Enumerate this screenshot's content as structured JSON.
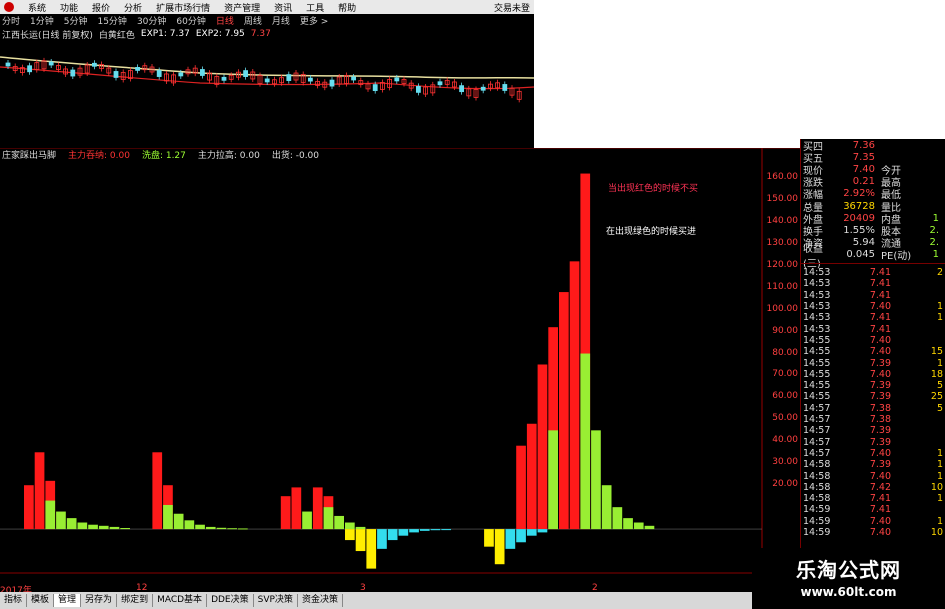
{
  "menu": {
    "items": [
      "系统",
      "功能",
      "报价",
      "分析",
      "扩展市场行情",
      "资产管理",
      "资讯",
      "工具",
      "帮助"
    ],
    "right": "交易未登"
  },
  "periods": {
    "items": [
      "分时",
      "1分钟",
      "5分钟",
      "15分钟",
      "30分钟",
      "60分钟",
      "日线",
      "周线",
      "月线",
      "更多 >"
    ],
    "selected": 6
  },
  "stock_title": {
    "name": "江西长运(日线 前复权)",
    "series": "白黄红色",
    "exp1": "EXP1: 7.37",
    "exp2": "EXP2: 7.95",
    "value3": "7.37"
  },
  "indicator_bar": {
    "name": "庄家踩出马脚",
    "k1": "主力吞纳: 0.00",
    "k2": "洗盘: 1.27",
    "k3": "主力拉高: 0.00",
    "k4": "出货: -0.00"
  },
  "annotations": {
    "red_text": "当出现红色的时候不买",
    "white_text": "在出现绿色的时候买进"
  },
  "colors": {
    "red": "#ff1a1a",
    "green": "#99ee33",
    "yellow": "#ffee00",
    "cyan": "#33ddee"
  },
  "chart_data": {
    "type": "bar",
    "ylim": [
      -20,
      170
    ],
    "yticks": [
      20,
      30,
      40,
      50,
      60,
      70,
      80,
      90,
      100,
      110,
      120,
      130,
      140,
      150,
      160
    ],
    "series": [
      {
        "color": "red",
        "values": [
          [
            0,
            0,
            20
          ],
          [
            1,
            0,
            35
          ],
          [
            2,
            0,
            22
          ],
          [
            12,
            0,
            35
          ],
          [
            13,
            0,
            20
          ],
          [
            24,
            0,
            15
          ],
          [
            25,
            0,
            19
          ],
          [
            27,
            0,
            19
          ],
          [
            28,
            0,
            15
          ],
          [
            46,
            0,
            38
          ],
          [
            47,
            0,
            48
          ],
          [
            48,
            0,
            75
          ],
          [
            49,
            0,
            92
          ],
          [
            50,
            0,
            108
          ],
          [
            51,
            0,
            122
          ],
          [
            52,
            0,
            162
          ]
        ]
      },
      {
        "color": "green",
        "values": [
          [
            2,
            0,
            13
          ],
          [
            3,
            0,
            8
          ],
          [
            4,
            0,
            5
          ],
          [
            5,
            0,
            3
          ],
          [
            6,
            0,
            2
          ],
          [
            7,
            0,
            1.5
          ],
          [
            8,
            0,
            1
          ],
          [
            9,
            0,
            0.5
          ],
          [
            13,
            0,
            11
          ],
          [
            14,
            0,
            7
          ],
          [
            15,
            0,
            4
          ],
          [
            16,
            0,
            2
          ],
          [
            17,
            0,
            1
          ],
          [
            18,
            0,
            0.6
          ],
          [
            19,
            0,
            0.4
          ],
          [
            20,
            0,
            0.3
          ],
          [
            26,
            0,
            8
          ],
          [
            28,
            0,
            10
          ],
          [
            29,
            0,
            6
          ],
          [
            30,
            0,
            3
          ],
          [
            31,
            0,
            1
          ],
          [
            49,
            0,
            45
          ],
          [
            52,
            0,
            80
          ],
          [
            53,
            0,
            45
          ],
          [
            54,
            0,
            20
          ],
          [
            55,
            0,
            10
          ],
          [
            56,
            0,
            5
          ],
          [
            57,
            0,
            3
          ],
          [
            58,
            0,
            1.5
          ]
        ]
      },
      {
        "color": "yellow",
        "values": [
          [
            30,
            -5,
            0
          ],
          [
            31,
            -10,
            0
          ],
          [
            32,
            -18,
            0
          ],
          [
            43,
            -8,
            0
          ],
          [
            44,
            -16,
            0
          ]
        ]
      },
      {
        "color": "cyan",
        "values": [
          [
            33,
            -9,
            0
          ],
          [
            34,
            -5,
            0
          ],
          [
            35,
            -3,
            0
          ],
          [
            36,
            -1.5,
            0
          ],
          [
            37,
            -0.8,
            0
          ],
          [
            38,
            -0.5,
            0
          ],
          [
            39,
            -0.3,
            0
          ],
          [
            45,
            -9,
            0
          ],
          [
            46,
            -6,
            0
          ],
          [
            47,
            -3,
            0
          ],
          [
            48,
            -1.5,
            0
          ]
        ]
      }
    ]
  },
  "xaxis": [
    {
      "label": "2017年",
      "pos": 0.0
    },
    {
      "label": "12",
      "pos": 0.17
    },
    {
      "label": "3",
      "pos": 0.45
    },
    {
      "label": "2",
      "pos": 0.74
    }
  ],
  "quote": {
    "rows": [
      {
        "lab": "买四",
        "val": "7.36",
        "vcolor": "#ff4444",
        "lab2": "",
        "val2": ""
      },
      {
        "lab": "买五",
        "val": "7.35",
        "vcolor": "#ff4444",
        "lab2": "",
        "val2": ""
      },
      {
        "lab": "现价",
        "val": "7.40",
        "vcolor": "#ff4444",
        "lab2": "今开",
        "val2": ""
      },
      {
        "lab": "涨跌",
        "val": "0.21",
        "vcolor": "#ff4444",
        "lab2": "最高",
        "val2": ""
      },
      {
        "lab": "涨幅",
        "val": "2.92%",
        "vcolor": "#ff4444",
        "lab2": "最低",
        "val2": ""
      },
      {
        "lab": "总量",
        "val": "36728",
        "vcolor": "#ffd700",
        "lab2": "量比",
        "val2": ""
      },
      {
        "lab": "外盘",
        "val": "20409",
        "vcolor": "#ff4444",
        "lab2": "内盘",
        "val2": "1"
      },
      {
        "lab": "换手",
        "val": "1.55%",
        "vcolor": "#ddd",
        "lab2": "股本",
        "val2": "2."
      },
      {
        "lab": "净资",
        "val": "5.94",
        "vcolor": "#ddd",
        "lab2": "流通",
        "val2": "2."
      },
      {
        "lab": "收益(三)",
        "val": "0.045",
        "vcolor": "#ddd",
        "lab2": "PE(动)",
        "val2": "1"
      }
    ],
    "ticks": [
      {
        "t": "14:53",
        "p": "7.41",
        "v": "2"
      },
      {
        "t": "14:53",
        "p": "7.41",
        "v": ""
      },
      {
        "t": "14:53",
        "p": "7.41",
        "v": ""
      },
      {
        "t": "14:53",
        "p": "7.40",
        "v": "1"
      },
      {
        "t": "14:53",
        "p": "7.41",
        "v": "1"
      },
      {
        "t": "14:53",
        "p": "7.41",
        "v": ""
      },
      {
        "t": "14:55",
        "p": "7.40",
        "v": ""
      },
      {
        "t": "14:55",
        "p": "7.40",
        "v": "15"
      },
      {
        "t": "14:55",
        "p": "7.39",
        "v": "1"
      },
      {
        "t": "14:55",
        "p": "7.40",
        "v": "18"
      },
      {
        "t": "14:55",
        "p": "7.39",
        "v": "5"
      },
      {
        "t": "14:55",
        "p": "7.39",
        "v": "25"
      },
      {
        "t": "14:57",
        "p": "7.38",
        "v": "5"
      },
      {
        "t": "14:57",
        "p": "7.38",
        "v": ""
      },
      {
        "t": "14:57",
        "p": "7.39",
        "v": ""
      },
      {
        "t": "14:57",
        "p": "7.39",
        "v": ""
      },
      {
        "t": "14:57",
        "p": "7.40",
        "v": "1"
      },
      {
        "t": "14:58",
        "p": "7.39",
        "v": "1"
      },
      {
        "t": "14:58",
        "p": "7.40",
        "v": "1"
      },
      {
        "t": "14:58",
        "p": "7.42",
        "v": "10"
      },
      {
        "t": "14:58",
        "p": "7.41",
        "v": "1"
      },
      {
        "t": "14:59",
        "p": "7.41",
        "v": ""
      },
      {
        "t": "14:59",
        "p": "7.40",
        "v": "1"
      },
      {
        "t": "14:59",
        "p": "7.40",
        "v": "10"
      }
    ]
  },
  "tabs": {
    "items": [
      "指标",
      "模板",
      "管理",
      "另存为",
      "绑定到",
      "MACD基本",
      "DDE决策",
      "SVP决策",
      "资金决策"
    ],
    "selected": 2
  },
  "watermark": {
    "line1": "乐淘公式网",
    "line2": "www.60lt.com"
  }
}
